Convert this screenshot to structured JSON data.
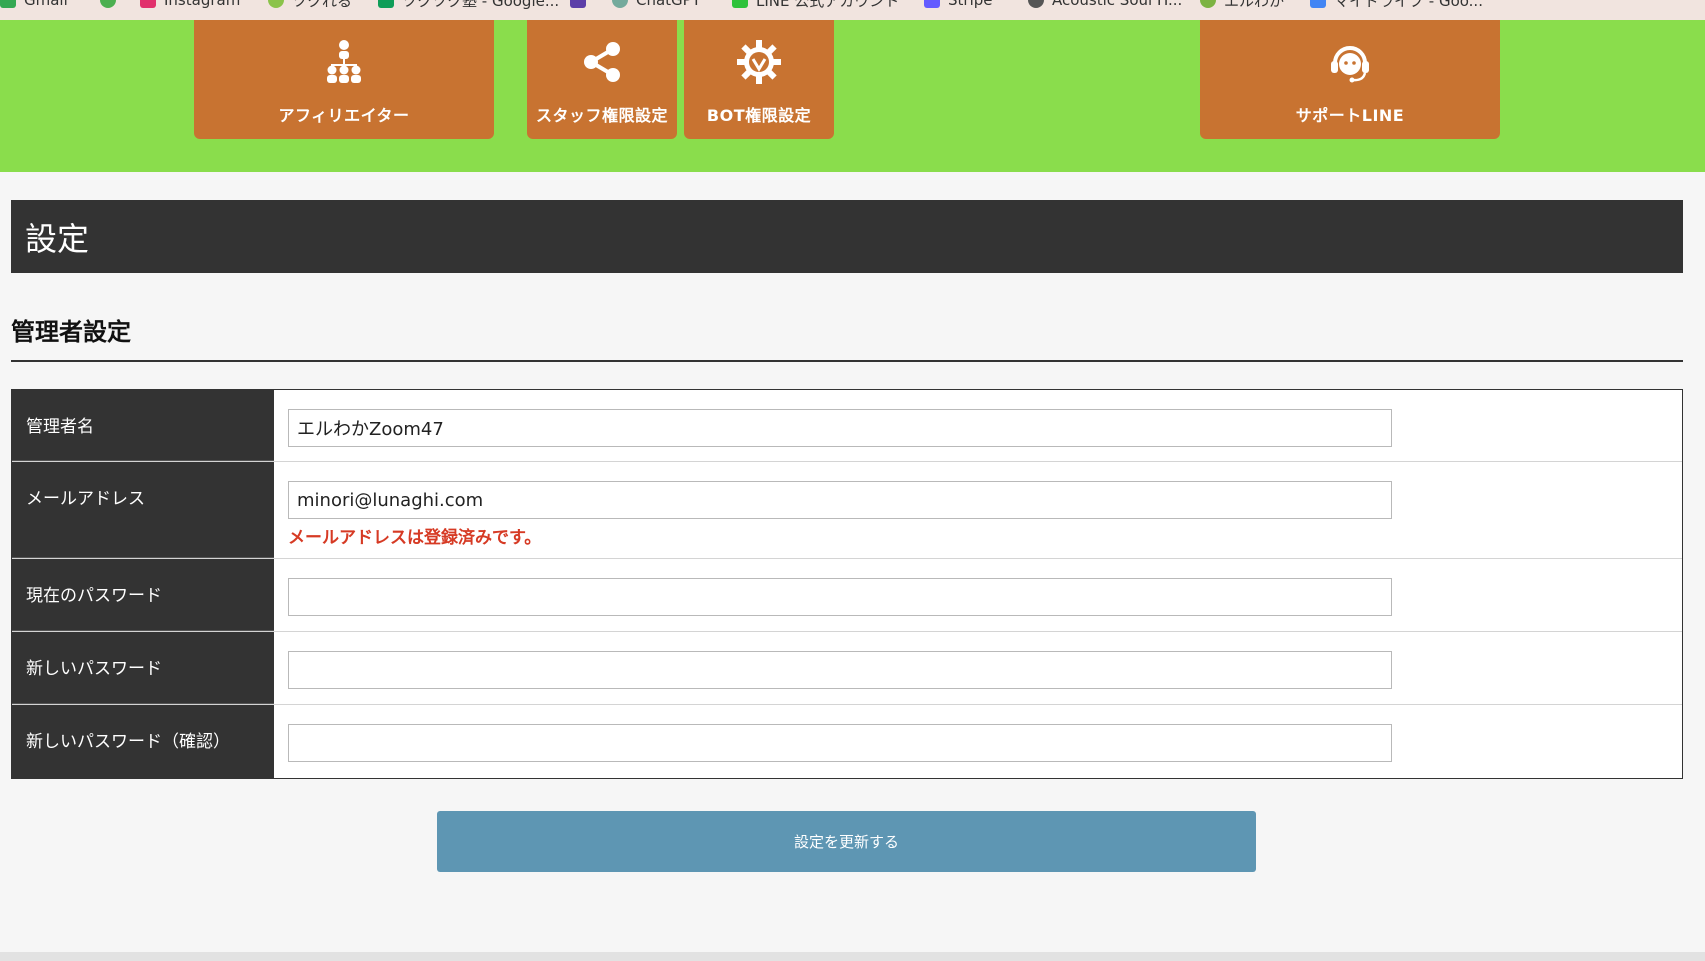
{
  "bookmarks": [
    {
      "label": "Gmail",
      "icon": "gmail-icon",
      "color": "#34a853"
    },
    {
      "label": "",
      "icon": "circle-icon",
      "color": "#4caf50"
    },
    {
      "label": "Instagram",
      "icon": "instagram-icon",
      "color": "#e1306c"
    },
    {
      "label": "ツクれる",
      "icon": "bird-icon",
      "color": "#8bc34a"
    },
    {
      "label": "ツクツク塾 - Google...",
      "icon": "sheets-icon",
      "color": "#0f9d58"
    },
    {
      "label": "",
      "icon": "square-icon",
      "color": "#5c3ea8"
    },
    {
      "label": "ChatGPT",
      "icon": "chatgpt-icon",
      "color": "#74aa9c"
    },
    {
      "label": "LINE 公式アカウント",
      "icon": "shield-icon",
      "color": "#2ec23a"
    },
    {
      "label": "Stripe",
      "icon": "stripe-icon",
      "color": "#635bff"
    },
    {
      "label": "Acoustic Soul H...",
      "icon": "gear-icon",
      "color": "#555555"
    },
    {
      "label": "エルわか",
      "icon": "frog-icon",
      "color": "#7cb342"
    },
    {
      "label": "マイドライブ - Goo...",
      "icon": "drive-icon",
      "color": "#4285f4"
    }
  ],
  "nav": {
    "tiles": [
      {
        "label": "アフィリエイター",
        "icon": "affiliate-network-icon"
      },
      {
        "label": "スタッフ権限設定",
        "icon": "share-icon"
      },
      {
        "label": "BOT権限設定",
        "icon": "bot-gear-icon"
      },
      {
        "label": "サポートLINE",
        "icon": "headset-support-icon"
      }
    ],
    "band_color": "#8add4c",
    "tile_color": "#c87331"
  },
  "page": {
    "title": "設定",
    "section_title": "管理者設定"
  },
  "form": {
    "rows": [
      {
        "label": "管理者名",
        "value": "エルわかZoom47",
        "placeholder": ""
      },
      {
        "label": "メールアドレス",
        "value": "minori@lunaghi.com",
        "placeholder": "",
        "error": "メールアドレスは登録済みです。"
      },
      {
        "label": "現在のパスワード",
        "value": "",
        "placeholder": ""
      },
      {
        "label": "新しいパスワード",
        "value": "",
        "placeholder": ""
      },
      {
        "label": "新しいパスワード（確認）",
        "value": "",
        "placeholder": ""
      }
    ],
    "submit_label": "設定を更新する",
    "submit_color": "#5e96b3",
    "error_color": "#d63a24"
  }
}
